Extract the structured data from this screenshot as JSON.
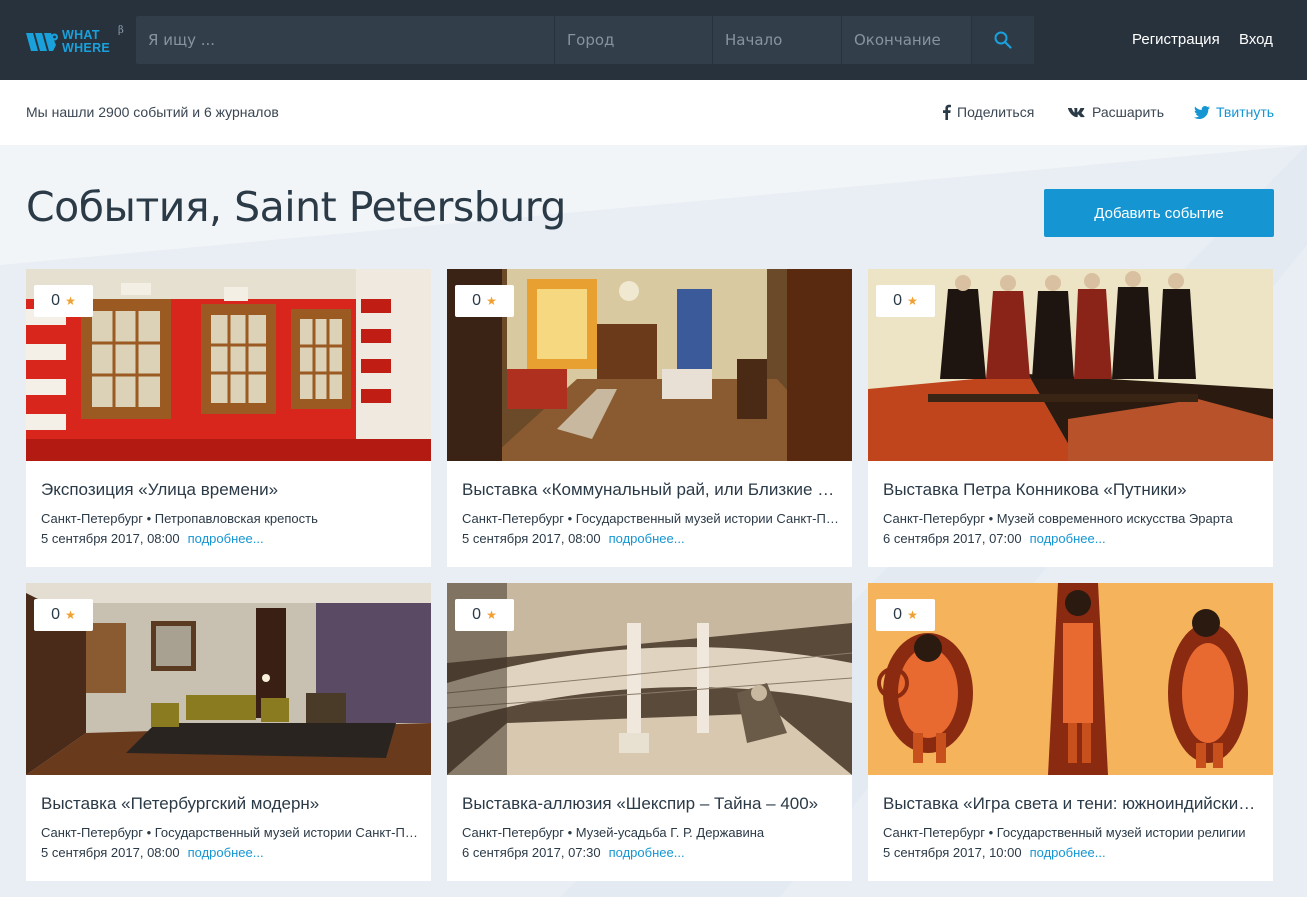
{
  "header": {
    "logo_line1": "WHAT",
    "logo_line2": "WHERE",
    "logo_beta": "β",
    "search_placeholder": "Я ищу ...",
    "city_placeholder": "Город",
    "start_placeholder": "Начало",
    "end_placeholder": "Окончание",
    "register_label": "Регистрация",
    "login_label": "Вход"
  },
  "results": {
    "summary": "Мы нашли 2900 событий и 6 журналов",
    "share_facebook": "Поделиться",
    "share_vk": "Расшарить",
    "share_twitter": "Твитнуть"
  },
  "page": {
    "title": "События, Saint Petersburg",
    "add_event_label": "Добавить событие"
  },
  "more_label": "подробнее...",
  "events": [
    {
      "rating": "0",
      "title": "Экспозиция «Улица времени»",
      "place": "Санкт-Петербург • Петропавловская крепость",
      "date": "5 сентября 2017, 08:00"
    },
    {
      "rating": "0",
      "title": "Выставка «Коммунальный рай, или Близкие люди»",
      "place": "Санкт-Петербург • Государственный музей истории Санкт-Петербурга",
      "date": "5 сентября 2017, 08:00"
    },
    {
      "rating": "0",
      "title": "Выставка Петра Конникова «Путники»",
      "place": "Санкт-Петербург • Музей современного искусства Эрарта",
      "date": "6 сентября 2017, 07:00"
    },
    {
      "rating": "0",
      "title": "Выставка «Петербургский модерн»",
      "place": "Санкт-Петербург • Государственный музей истории Санкт-Петербурга",
      "date": "5 сентября 2017, 08:00"
    },
    {
      "rating": "0",
      "title": "Выставка-аллюзия «Шекспир – Тайна – 400»",
      "place": "Санкт-Петербург • Музей-усадьба Г. Р. Державина",
      "date": "6 сентября 2017, 07:30"
    },
    {
      "rating": "0",
      "title": "Выставка «Игра света и тени: южноиндийский театр теней»",
      "place": "Санкт-Петербург • Государственный музей истории религии",
      "date": "5 сентября 2017, 10:00"
    }
  ],
  "colors": {
    "header_bg": "#27323d",
    "accent": "#1596d3",
    "star": "#f0a030"
  }
}
